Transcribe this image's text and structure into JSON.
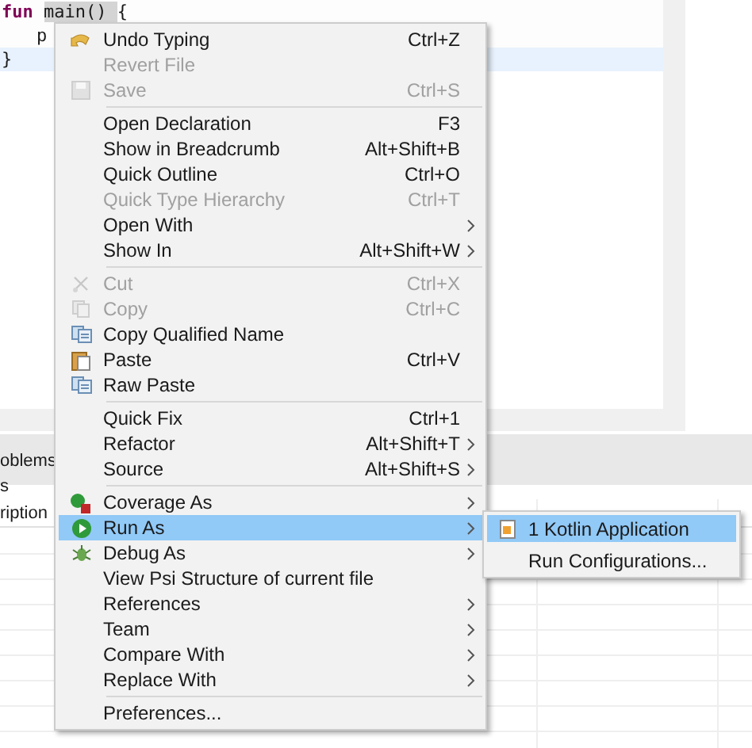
{
  "editor": {
    "lines": [
      {
        "keyword": "fun",
        "name": "main()",
        "rest": "{",
        "current": false
      },
      {
        "rest": "p",
        "current": false
      },
      {
        "rest": "}",
        "current": true
      }
    ]
  },
  "problems_panel": {
    "tab": "oblems",
    "line_2": "s",
    "column_1": "ription"
  },
  "context_menu": {
    "sections": [
      [
        {
          "label": "Undo Typing",
          "shortcut": "Ctrl+Z",
          "submenu": false,
          "disabled": false,
          "selected": false
        },
        {
          "label": "Revert File",
          "submenu": false,
          "disabled": true,
          "selected": false
        },
        {
          "label": "Save",
          "shortcut": "Ctrl+S",
          "submenu": false,
          "disabled": true,
          "selected": false
        }
      ],
      [
        {
          "label": "Open Declaration",
          "shortcut": "F3",
          "submenu": false,
          "disabled": false,
          "selected": false
        },
        {
          "label": "Show in Breadcrumb",
          "shortcut": "Alt+Shift+B",
          "submenu": false,
          "disabled": false,
          "selected": false
        },
        {
          "label": "Quick Outline",
          "shortcut": "Ctrl+O",
          "submenu": false,
          "disabled": false,
          "selected": false
        },
        {
          "label": "Quick Type Hierarchy",
          "shortcut": "Ctrl+T",
          "submenu": false,
          "disabled": true,
          "selected": false
        },
        {
          "label": "Open With",
          "submenu": true,
          "disabled": false,
          "selected": false
        },
        {
          "label": "Show In",
          "shortcut": "Alt+Shift+W",
          "submenu": true,
          "disabled": false,
          "selected": false
        }
      ],
      [
        {
          "label": "Cut",
          "shortcut": "Ctrl+X",
          "submenu": false,
          "disabled": true,
          "selected": false
        },
        {
          "label": "Copy",
          "shortcut": "Ctrl+C",
          "submenu": false,
          "disabled": true,
          "selected": false
        },
        {
          "label": "Copy Qualified Name",
          "submenu": false,
          "disabled": false,
          "selected": false
        },
        {
          "label": "Paste",
          "shortcut": "Ctrl+V",
          "submenu": false,
          "disabled": false,
          "selected": false
        },
        {
          "label": "Raw Paste",
          "submenu": false,
          "disabled": false,
          "selected": false
        }
      ],
      [
        {
          "label": "Quick Fix",
          "shortcut": "Ctrl+1",
          "submenu": false,
          "disabled": false,
          "selected": false
        },
        {
          "label": "Refactor",
          "shortcut": "Alt+Shift+T",
          "submenu": true,
          "disabled": false,
          "selected": false
        },
        {
          "label": "Source",
          "shortcut": "Alt+Shift+S",
          "submenu": true,
          "disabled": false,
          "selected": false
        }
      ],
      [
        {
          "label": "Coverage As",
          "submenu": true,
          "disabled": false,
          "selected": false
        },
        {
          "label": "Run As",
          "submenu": true,
          "disabled": false,
          "selected": true
        },
        {
          "label": "Debug As",
          "submenu": true,
          "disabled": false,
          "selected": false
        },
        {
          "label": "View Psi Structure of current file",
          "submenu": false,
          "disabled": false,
          "selected": false
        },
        {
          "label": "References",
          "submenu": true,
          "disabled": false,
          "selected": false
        },
        {
          "label": "Team",
          "submenu": true,
          "disabled": false,
          "selected": false
        },
        {
          "label": "Compare With",
          "submenu": true,
          "disabled": false,
          "selected": false
        },
        {
          "label": "Replace With",
          "submenu": true,
          "disabled": false,
          "selected": false
        }
      ],
      [
        {
          "label": "Preferences...",
          "submenu": false,
          "disabled": false,
          "selected": false
        }
      ]
    ]
  },
  "run_as_submenu": {
    "sections": [
      [
        {
          "label": "1 Kotlin Application",
          "selected": true
        }
      ],
      [
        {
          "label": "Run Configurations...",
          "selected": false
        }
      ]
    ]
  }
}
